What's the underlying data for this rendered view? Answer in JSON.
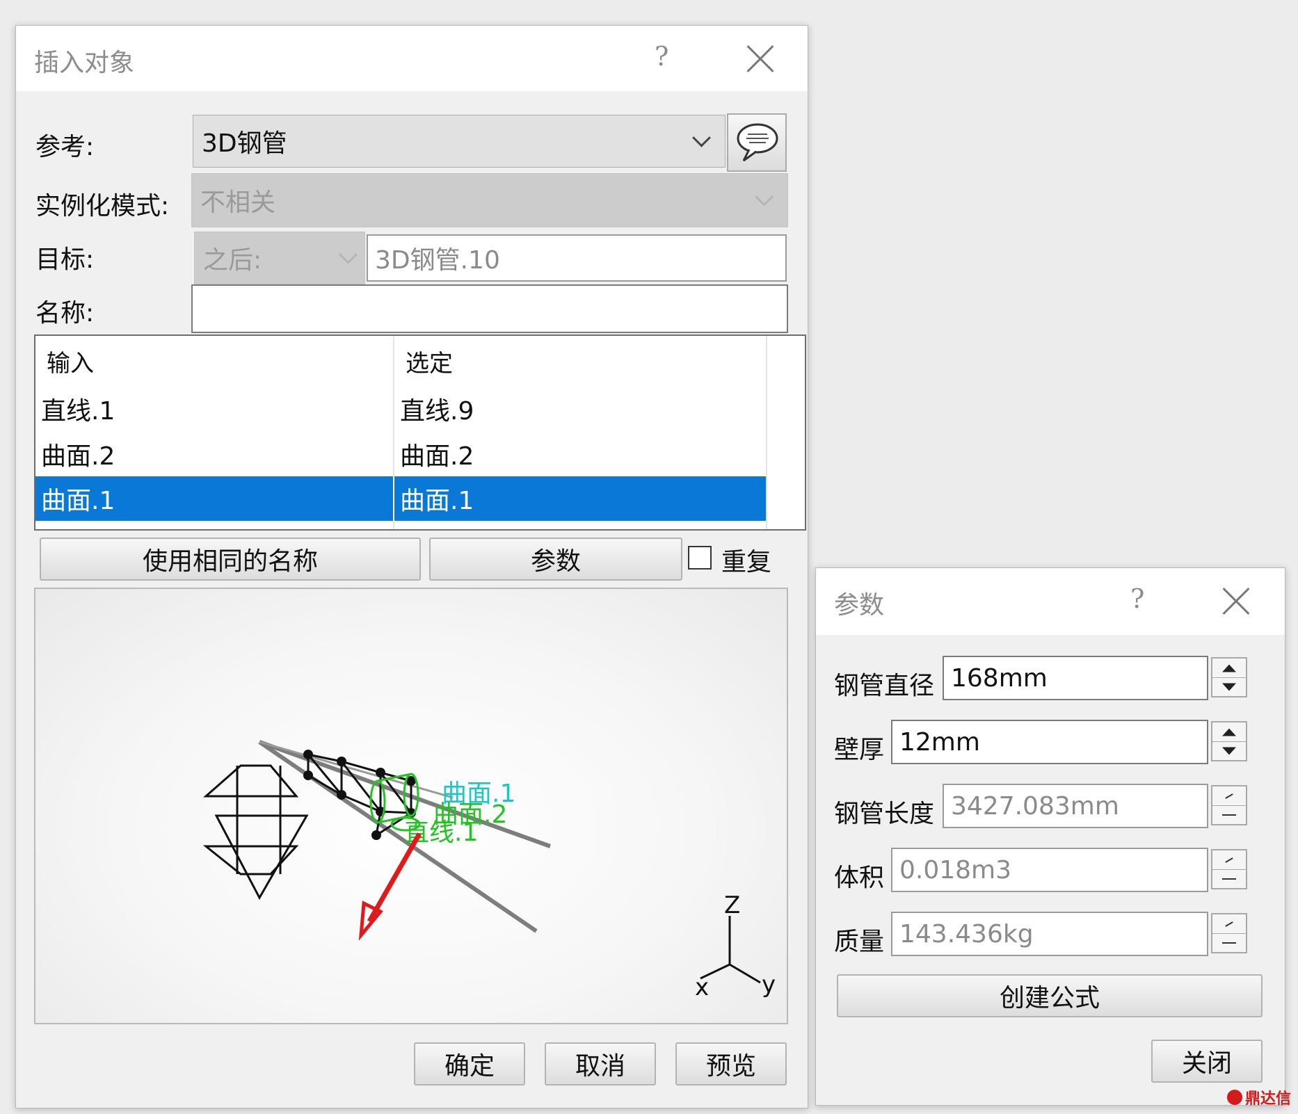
{
  "insert_dialog": {
    "title": "插入对象",
    "help": "?",
    "reference_label": "参考:",
    "reference_value": "3D钢管",
    "instantiation_label": "实例化模式:",
    "instantiation_value": "不相关",
    "target_label": "目标:",
    "target_mode": "之后:",
    "target_value": "3D钢管.10",
    "name_label": "名称:",
    "name_value": "",
    "table": {
      "headers": [
        "输入",
        "选定"
      ],
      "rows": [
        {
          "input": "直线.1",
          "selected": "直线.9"
        },
        {
          "input": "曲面.2",
          "selected": "曲面.2"
        },
        {
          "input": "曲面.1",
          "selected": "曲面.1"
        }
      ],
      "selected_row": 2
    },
    "use_same_name_button": "使用相同的名称",
    "parameters_button": "参数",
    "repeat_label": "重复",
    "repeat_checked": false,
    "viewer": {
      "labels": [
        "曲面.1",
        "曲面.2",
        "直线.1"
      ],
      "axes": {
        "z": "Z",
        "x": "x",
        "y": "y"
      }
    },
    "ok_button": "确定",
    "cancel_button": "取消",
    "preview_button": "预览"
  },
  "params_dialog": {
    "title": "参数",
    "help": "?",
    "fields": [
      {
        "label": "钢管直径",
        "value": "168mm",
        "editable": true
      },
      {
        "label": "壁厚",
        "value": "12mm",
        "editable": true
      },
      {
        "label": "钢管长度",
        "value": "3427.083mm",
        "editable": false
      },
      {
        "label": "体积",
        "value": "0.018m3",
        "editable": false
      },
      {
        "label": "质量",
        "value": "143.436kg",
        "editable": false
      }
    ],
    "create_formula_button": "创建公式",
    "close_button": "关闭"
  },
  "watermark": "鼎达信",
  "colors": {
    "selection": "#0a78d7",
    "label_green": "#22c322",
    "label_cyan": "#18c8c8",
    "arrow_red": "#e01a1a"
  }
}
